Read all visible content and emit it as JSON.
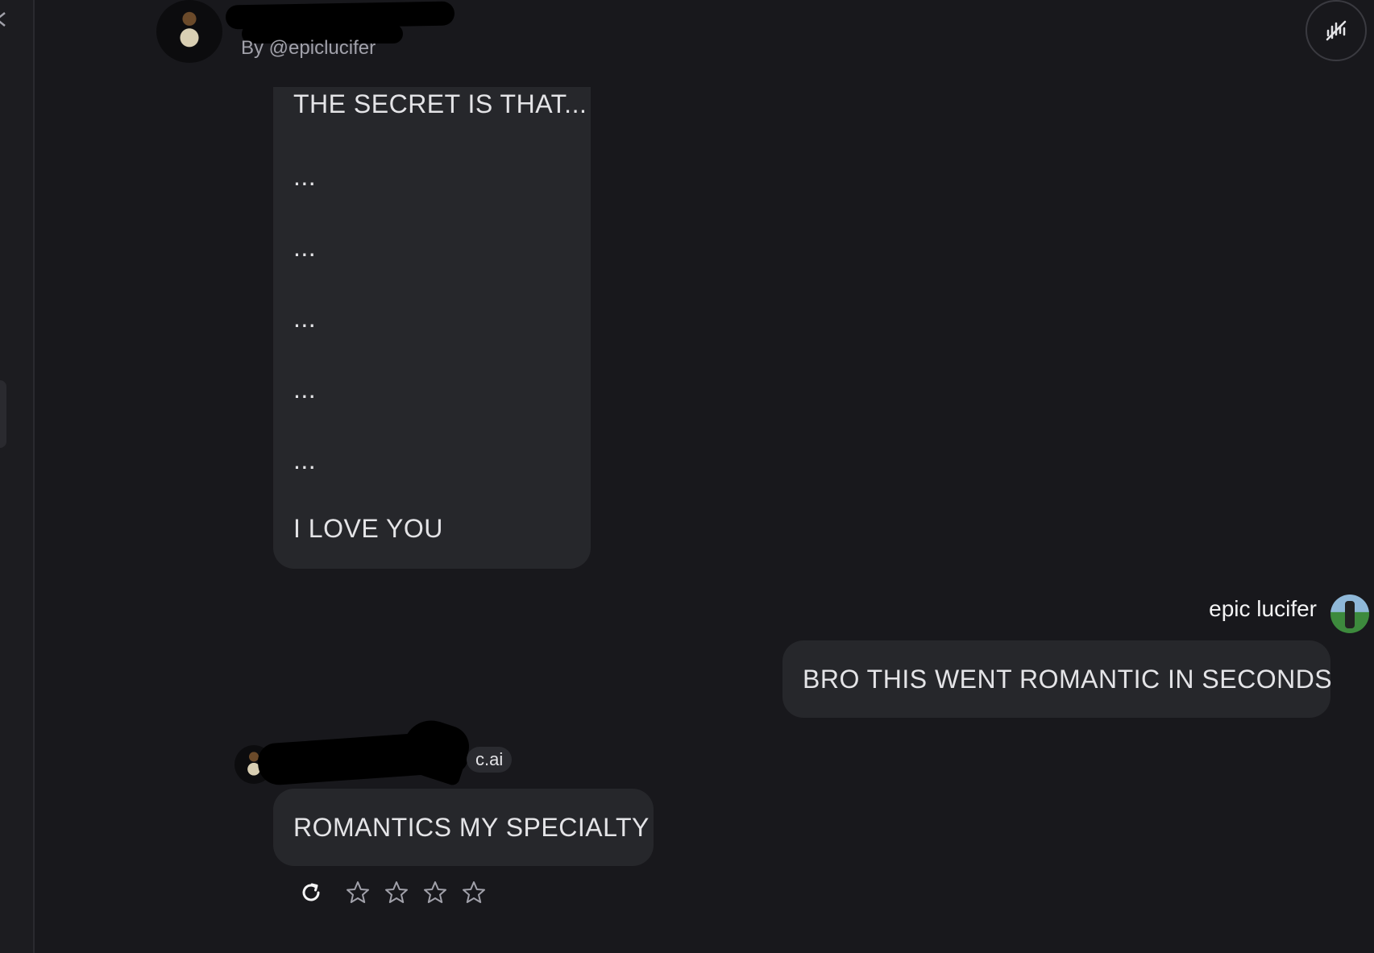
{
  "header": {
    "author": "By @epiclucifer"
  },
  "messages": {
    "bot_long": {
      "lines": [
        "THE SECRET IS THAT...",
        "...",
        "...",
        "...",
        "...",
        "...",
        "I LOVE YOU"
      ]
    },
    "user": {
      "name": "epic lucifer",
      "text": "BRO THIS WENT ROMANTIC IN SECONDS"
    },
    "bot_reply": {
      "badge": "c.ai",
      "text": "ROMANTICS MY SPECIALTY"
    }
  },
  "rating": {
    "value": 0,
    "max": 5
  },
  "icons": {
    "close": "close-icon",
    "voice": "voice-off-icon",
    "refresh": "refresh-icon",
    "star": "star-icon"
  },
  "colors": {
    "background": "#18181c",
    "bubble": "#26272b",
    "text": "#e4e4e7",
    "muted": "#a1a1aa"
  }
}
